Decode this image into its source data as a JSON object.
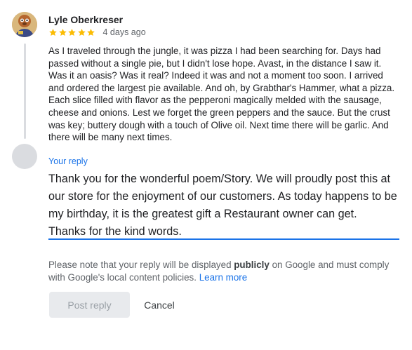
{
  "review": {
    "author_name": "Lyle Oberkreser",
    "rating": 5,
    "date": "4 days ago",
    "text": "As I traveled through the jungle, it was pizza I had been searching for. Days had passed without a single pie, but I didn't lose hope. Avast, in the distance I saw it. Was it an oasis? Was it real? Indeed it was and not a moment too soon. I arrived and ordered the largest pie available. And oh, by Grabthar's Hammer, what a pizza. Each slice filled with flavor as the pepperoni magically melded with the sausage, cheese and onions. Lest we forget the green peppers and the sauce. But the crust was key; buttery dough with a touch of Olive oil. Next time there will be garlic. And there will be many next times."
  },
  "reply": {
    "label": "Your reply",
    "text": "Thank you for the wonderful poem/Story. We will proudly post this at our store for the enjoyment of our customers. As today happens to be my  birthday, it is the greatest gift a Restaurant owner can get.\nThanks for the kind words."
  },
  "note": {
    "prefix": "Please note that your reply will be displayed ",
    "bold": "publicly",
    "suffix": " on Google and must comply with Google's local content policies. ",
    "link": "Learn more"
  },
  "actions": {
    "post_label": "Post reply",
    "cancel_label": "Cancel"
  },
  "colors": {
    "accent": "#1a73e8",
    "star": "#fbbc04",
    "muted_text": "#5f6368",
    "placeholder_avatar": "#dadce0"
  },
  "icons": {
    "reviewer_avatar": "reviewer-avatar-image",
    "star": "star-icon"
  }
}
